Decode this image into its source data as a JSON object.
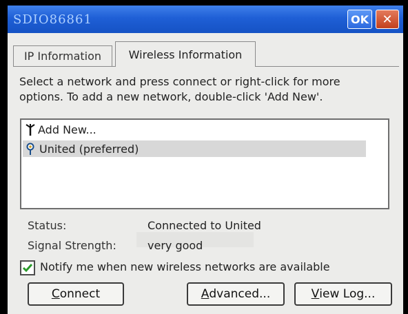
{
  "window": {
    "title": "SDIO86861",
    "ok_label": "OK",
    "close_label": "✕"
  },
  "tabs": [
    {
      "label": "IP Information",
      "active": false
    },
    {
      "label": "Wireless Information",
      "active": true
    }
  ],
  "instructions": "Select a network and press connect or right-click for more options.  To add a new network, double-click 'Add New'.",
  "networks": [
    {
      "label": "Add New...",
      "icon": "antenna-icon",
      "selected": false
    },
    {
      "label": "United (preferred)",
      "icon": "network-pin-icon",
      "selected": true
    }
  ],
  "status": {
    "status_label": "Status:",
    "status_value": "Connected to United",
    "signal_label": "Signal Strength:",
    "signal_value": "very good"
  },
  "notify": {
    "checked": true,
    "label": "Notify me when new wireless networks are available"
  },
  "buttons": {
    "connect_first": "C",
    "connect_rest": "onnect",
    "advanced_first": "A",
    "advanced_rest": "dvanced...",
    "viewlog_first": "V",
    "viewlog_rest": "iew Log..."
  },
  "colors": {
    "titlebar": "#1f5fd6",
    "close": "#c2401d",
    "check": "#2a9a2a"
  }
}
